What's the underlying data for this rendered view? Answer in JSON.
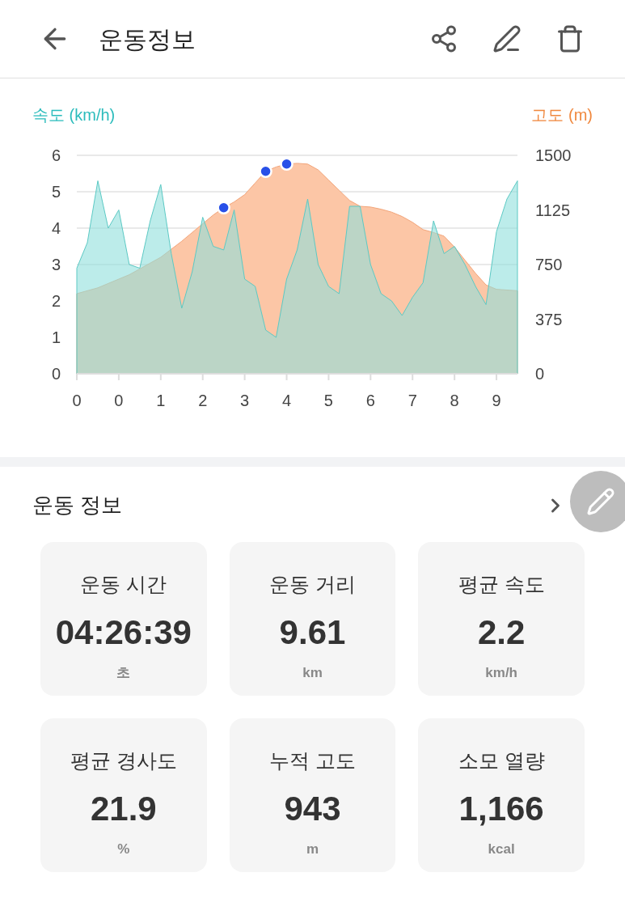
{
  "header": {
    "title": "운동정보"
  },
  "chart": {
    "chart_data": {
      "type": "area",
      "grid": true,
      "categories": [
        "0",
        null,
        null,
        null,
        "0",
        null,
        null,
        null,
        "1",
        null,
        null,
        null,
        "2",
        null,
        null,
        null,
        "3",
        null,
        null,
        null,
        "4",
        null,
        null,
        null,
        "5",
        null,
        null,
        null,
        "6",
        null,
        null,
        null,
        "7",
        null,
        null,
        null,
        "8",
        null,
        null,
        null,
        "9",
        null,
        null
      ],
      "ylim": [
        0,
        6
      ],
      "yticks": [
        0,
        1,
        2,
        3,
        4,
        5,
        6
      ],
      "y2lim": [
        0,
        1500
      ],
      "y2ticks": [
        0,
        375,
        750,
        1125,
        1500
      ],
      "series": [
        {
          "name": "속도 (km/h)",
          "color": "#8fdfdc",
          "values": [
            2.9,
            3.6,
            5.3,
            4.0,
            4.5,
            3.0,
            2.9,
            4.2,
            5.2,
            3.3,
            1.8,
            2.8,
            4.3,
            3.5,
            3.4,
            4.5,
            2.6,
            2.4,
            1.2,
            1.0,
            2.6,
            3.4,
            4.8,
            3.0,
            2.4,
            2.2,
            4.6,
            4.6,
            3.0,
            2.2,
            2.0,
            1.6,
            2.1,
            2.5,
            4.2,
            3.3,
            3.5,
            3.0,
            2.4,
            1.9,
            3.9,
            4.8,
            5.3
          ]
        },
        {
          "name": "고도 (m)",
          "color": "#fcc6a6",
          "axis": "y2",
          "values": [
            550,
            570,
            590,
            620,
            650,
            680,
            720,
            760,
            800,
            855,
            910,
            970,
            1030,
            1090,
            1140,
            1180,
            1230,
            1310,
            1390,
            1420,
            1440,
            1445,
            1440,
            1400,
            1330,
            1260,
            1190,
            1150,
            1145,
            1130,
            1110,
            1080,
            1040,
            990,
            970,
            945,
            870,
            780,
            690,
            610,
            580,
            575,
            570
          ]
        }
      ]
    }
  },
  "section": {
    "title": "운동 정보"
  },
  "stats": [
    {
      "label": "운동 시간",
      "value": "04:26:39",
      "unit": "초"
    },
    {
      "label": "운동 거리",
      "value": "9.61",
      "unit": "km"
    },
    {
      "label": "평균 속도",
      "value": "2.2",
      "unit": "km/h"
    },
    {
      "label": "평균 경사도",
      "value": "21.9",
      "unit": "%"
    },
    {
      "label": "누적 고도",
      "value": "943",
      "unit": "m"
    },
    {
      "label": "소모 열량",
      "value": "1,166",
      "unit": "kcal"
    }
  ]
}
